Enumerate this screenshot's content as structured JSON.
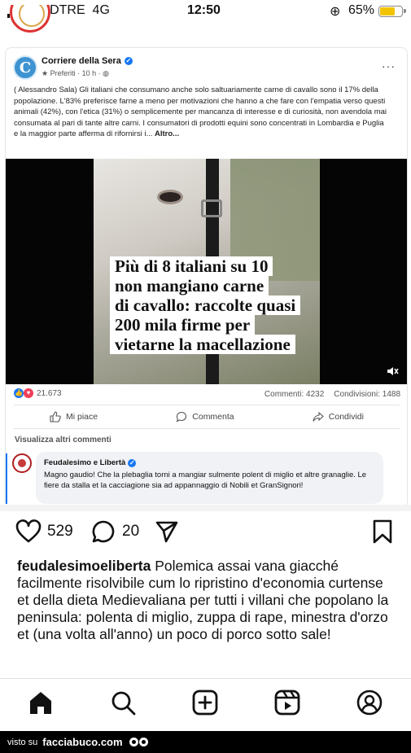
{
  "status_bar": {
    "carrier": "WINDTRE",
    "network": "4G",
    "time": "12:50",
    "battery": "65%",
    "battery_level": 0.65
  },
  "fb_post": {
    "page_name": "Corriere della Sera",
    "meta": "Preferiti · 10 h ·",
    "more_label": "···",
    "text": "( Alessandro Sala) Gli italiani che consumano anche solo saltuariamente carne di cavallo sono il 17% della popolazione. L'83% preferisce farne a meno per motivazioni che hanno a che fare con l'empatia verso questi animali (42%), con l'etica (31%) o semplicemente per mancanza di interesse e di curiosità, non avendola mai consumata al pari di tante altre carni. I consumatori di prodotti equini sono concentrati in Lombardia e Puglia e la maggior parte afferma di rifornirsi  i...",
    "more_link": "Altro...",
    "video_caption": [
      "Più di 8 italiani su 10",
      "non mangiano carne",
      "di cavallo: raccolte quasi",
      "200 mila firme per",
      "vietarne la macellazione"
    ],
    "reactions_count": "21.673",
    "comments": "Commenti: 4232",
    "shares": "Condivisioni: 1488",
    "actions": {
      "like": "Mi piace",
      "comment": "Commenta",
      "share": "Condividi"
    },
    "more_comments": "Visualizza altri commenti",
    "comment": {
      "author": "Feudalesimo e Libertà",
      "text": "Magno gaudio! Che la plebaglia torni a mangiar sulmente polent di miglio et altre granaglie. Le fiere da stalla et la cacciagione sia ad appannaggio di Nobili et GranSignori!"
    }
  },
  "ig": {
    "likes": "529",
    "comments": "20",
    "username": "feudalesimoeliberta",
    "caption": "Polemica assai vana giacché facilmente risolvibile cum lo ripristino d'economia curtense et della dieta Medievaliana per tutti i villani che popolano la peninsula: polenta di miglio, zuppa di rape, minestra d'orzo et (una volta all'anno) un poco di porco sotto sale!"
  },
  "footer": {
    "prefix": "visto su",
    "brand": "facciabuco.com"
  },
  "colors": {
    "fb_blue": "#1877f2",
    "battery_yellow": "#f2c400"
  }
}
